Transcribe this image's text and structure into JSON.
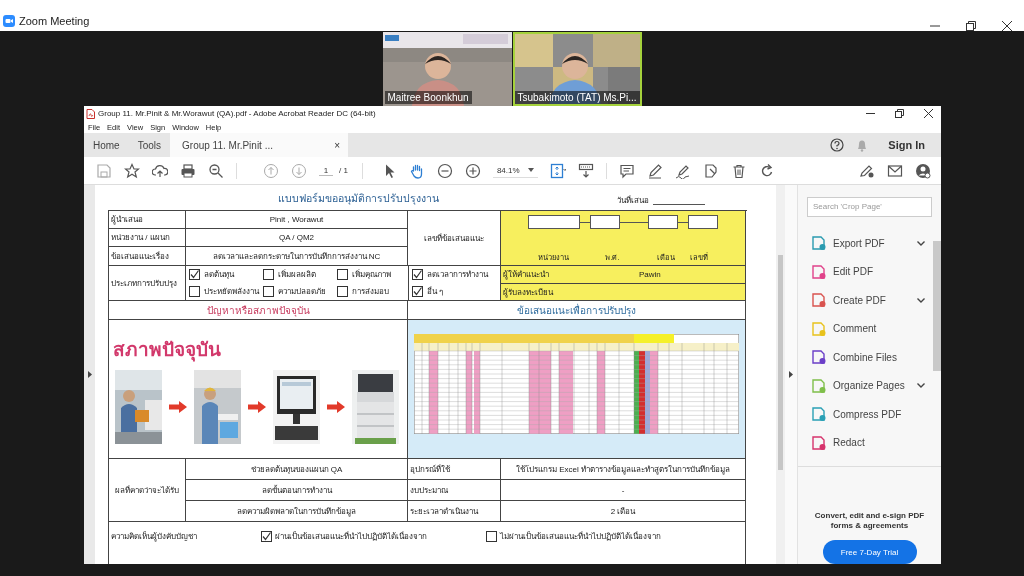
{
  "zoom": {
    "title": "Zoom Meeting"
  },
  "participants": [
    {
      "name": "Maitree Boonkhun",
      "speaking": false
    },
    {
      "name": "Tsubakimoto (TAT) Ms.Pi...",
      "speaking": true
    }
  ],
  "acrobat": {
    "title": "Group 11. Mr.Pinit & Mr.Worawut (QA).pdf - Adobe Acrobat Reader DC (64-bit)",
    "menu": [
      "File",
      "Edit",
      "View",
      "Sign",
      "Window",
      "Help"
    ],
    "tabs": [
      {
        "label": "Home",
        "selected": false
      },
      {
        "label": "Tools",
        "selected": false
      },
      {
        "label": "Group 11. Mr.Pinit ...",
        "selected": true,
        "close": "×"
      }
    ],
    "sign_in": "Sign In",
    "page_current": "1",
    "page_total": "/ 1",
    "zoom_level": "84.1%"
  },
  "form": {
    "title": "แบบฟอร์มขออนุมัติการปรับปรุงงาน",
    "date_label": "วันที่เสนอ",
    "info_rows": [
      {
        "label": "ผู้นำเสนอ",
        "value": "Pinit , Worawut"
      },
      {
        "label": "หน่วยงาน / แผนก",
        "value": "QA / QM2"
      },
      {
        "label": "ข้อเสนอแนะเรื่อง",
        "value": "ลดเวลาและลดกระดาษในการบันทึกการส่งงาน NC"
      }
    ],
    "number_label": "เลขที่ข้อเสนอแนะ",
    "number_parts": [
      "หน่วยงาน",
      "พ.ศ.",
      "เดือน",
      "เลขที่"
    ],
    "type_label": "ประเภทการปรับปรุง",
    "types": [
      {
        "label": "ลดต้นทุน",
        "checked": true
      },
      {
        "label": "เพิ่มผลผลิต",
        "checked": false
      },
      {
        "label": "เพิ่มคุณภาพ",
        "checked": false
      },
      {
        "label": "ลดเวลาการทำงาน",
        "checked": true
      },
      {
        "label": "ประหยัดพลังงาน",
        "checked": false
      },
      {
        "label": "ความปลอดภัย",
        "checked": false
      },
      {
        "label": "การส่งมอบ",
        "checked": false
      },
      {
        "label": "อื่น ๆ",
        "checked": true
      }
    ],
    "advisor": {
      "label": "ผู้ให้คำแนะนำ",
      "value": "Pawin"
    },
    "registrar_label": "ผู้รับลงทะเบียน",
    "problem_heading": "ปัญหาหรือสภาพปัจจุบัน",
    "proposal_heading": "ข้อเสนอแนะเพื่อการปรับปรุง",
    "current_state_title": "สภาพปัจจุบัน",
    "photos": [
      {
        "kind": "picture"
      },
      {
        "kind": "picture"
      },
      {
        "kind": "picture"
      },
      {
        "kind": "picture"
      }
    ],
    "results_label": "ผลที่คาดว่าจะได้รับ",
    "results": [
      "ช่วยลดต้นทุนของแผนก QA",
      "ลดขั้นตอนการทำงาน",
      "ลดความผิดพลาดในการบันทึกข้อมูล"
    ],
    "details": [
      {
        "label": "อุปกรณ์ที่ใช้",
        "value": "ใช้โปรแกรม Excel ทำตารางข้อมูลและทำสูตรในการบันทึกข้อมูล"
      },
      {
        "label": "งบประมาณ",
        "value": "-"
      },
      {
        "label": "ระยะเวลาดำเนินงาน",
        "value": "2 เดือน"
      }
    ],
    "comment_label": "ความคิดเห็นผู้บังคับบัญชา",
    "approvals": [
      {
        "label": "ผ่านเป็นข้อเสนอแนะที่นำไปปฏิบัติได้เนื่องจาก",
        "checked": true
      },
      {
        "label": "ไม่ผ่านเป็นข้อเสนอแนะที่นำไปปฏิบัติได้เนื่องจาก",
        "checked": false
      }
    ]
  },
  "tools_panel": {
    "search_placeholder": "Search 'Crop Page'",
    "tools": [
      {
        "label": "Export PDF",
        "color": "#2a9bb0",
        "expandable": true
      },
      {
        "label": "Edit PDF",
        "color": "#e0428a",
        "expandable": false
      },
      {
        "label": "Create PDF",
        "color": "#d9534f",
        "expandable": true
      },
      {
        "label": "Comment",
        "color": "#e8c21c",
        "expandable": false
      },
      {
        "label": "Combine Files",
        "color": "#6b3fc8",
        "expandable": false
      },
      {
        "label": "Organize Pages",
        "color": "#7fbf4a",
        "expandable": true
      },
      {
        "label": "Compress PDF",
        "color": "#2aa0b5",
        "expandable": false
      },
      {
        "label": "Redact",
        "color": "#d6336c",
        "expandable": false
      }
    ],
    "promo": "Convert, edit and e-sign PDF forms & agreements",
    "trial_button": "Free 7-Day Trial"
  }
}
